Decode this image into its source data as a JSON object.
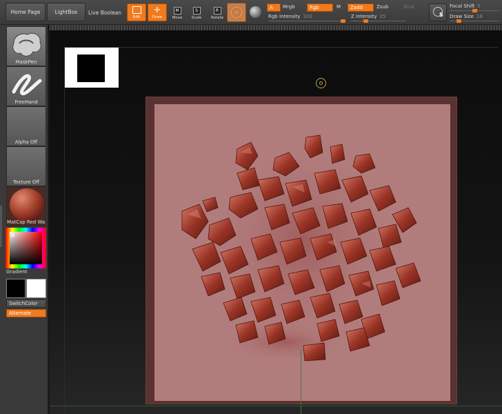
{
  "toolbar": {
    "home_page": "Home Page",
    "lightbox": "LightBox",
    "live_boolean": "Live Boolean",
    "edit": "Edit",
    "draw": "Draw",
    "move": "Move",
    "scale": "Scale",
    "rotate": "Rotate",
    "move_key": "M",
    "scale_key": "S",
    "rotate_key": "R",
    "a": "A",
    "mrgb": "Mrgb",
    "rgb": "Rgb",
    "m": "M",
    "zadd": "Zadd",
    "zsub": "Zsub",
    "zcut": "Zcut",
    "rgb_intensity_label": "Rgb Intensity",
    "rgb_intensity_value": "100",
    "z_intensity_label": "Z Intensity",
    "z_intensity_value": "25",
    "focal_shift_label": "Focal Shift",
    "focal_shift_value": "0",
    "draw_size_label": "Draw Size",
    "draw_size_value": "18",
    "draw_size_level": 0.15,
    "rgb_intensity_level": 1.0,
    "z_intensity_level": 0.25,
    "focal_shift_level": 0.5,
    "s_key": "S"
  },
  "left_panel": {
    "brush": "MaskPen",
    "stroke": "FreeHand",
    "alpha": "Alpha Off",
    "texture": "Texture Off",
    "material": "MatCap Red Wax",
    "gradient": "Gradient",
    "switch_color": "SwitchColor",
    "alternate": "Alternate"
  },
  "colors": {
    "accent": "#f07a1e",
    "canvas_pink": "#b17c7c",
    "wax_red": "#8e2e22"
  }
}
